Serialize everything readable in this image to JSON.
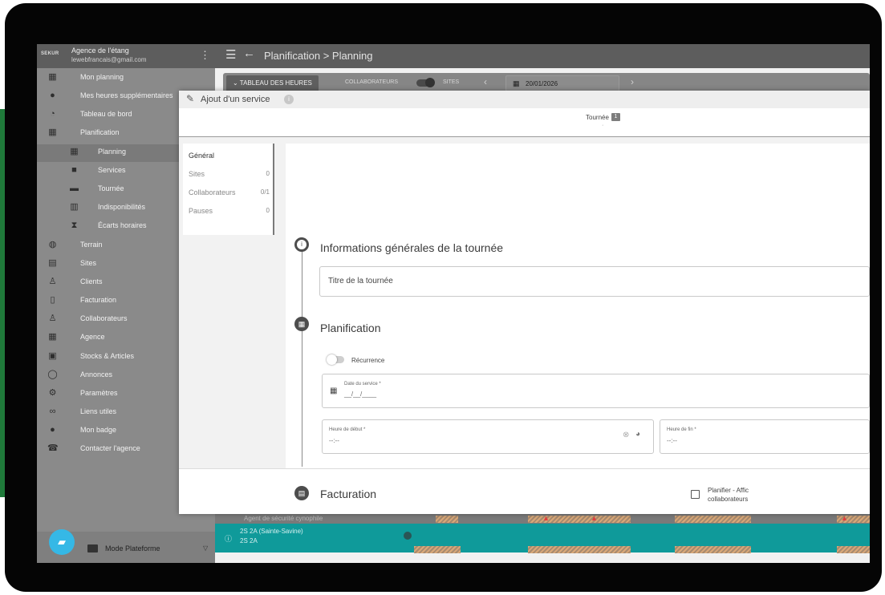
{
  "app": {
    "logo": "SEKUR",
    "agency_name": "Agence de l'étang",
    "agency_email": "lewebfrancais@gmail.com",
    "breadcrumb": "Planification  >  Planning"
  },
  "sidebar": {
    "items": [
      {
        "label": "Mon planning",
        "icon": "calendar-icon"
      },
      {
        "label": "Mes heures supplémentaires",
        "icon": "user-clock-icon"
      },
      {
        "label": "Tableau de bord",
        "icon": "dashboard-icon"
      },
      {
        "label": "Planification",
        "icon": "calendar-grid-icon"
      },
      {
        "label": "Planning",
        "icon": "calendar-icon"
      },
      {
        "label": "Services",
        "icon": "briefcase-icon"
      },
      {
        "label": "Tournée",
        "icon": "car-icon"
      },
      {
        "label": "Indisponibilités",
        "icon": "calendar-off-icon"
      },
      {
        "label": "Écarts horaires",
        "icon": "hourglass-icon"
      },
      {
        "label": "Terrain",
        "icon": "globe-icon"
      },
      {
        "label": "Sites",
        "icon": "building-icon"
      },
      {
        "label": "Clients",
        "icon": "client-icon"
      },
      {
        "label": "Facturation",
        "icon": "invoice-icon"
      },
      {
        "label": "Collaborateurs",
        "icon": "user-icon"
      },
      {
        "label": "Agence",
        "icon": "agency-icon"
      },
      {
        "label": "Stocks & Articles",
        "icon": "boxes-icon"
      },
      {
        "label": "Annonces",
        "icon": "chat-icon"
      },
      {
        "label": "Paramètres",
        "icon": "settings-icon"
      },
      {
        "label": "Liens utiles",
        "icon": "link-icon"
      },
      {
        "label": "Mon badge",
        "icon": "badge-icon"
      },
      {
        "label": "Contacter l'agence",
        "icon": "phone-icon"
      }
    ],
    "mode_label": "Mode Plateforme"
  },
  "toolbar": {
    "tab_hours": "TABLEAU DES HEURES",
    "collaborateurs": "COLLABORATEURS",
    "sites": "SITES",
    "date": "20/01/2026"
  },
  "background": {
    "row1_label": "Agent de sécurité cynophile",
    "row2_line1": "2S 2A (Sainte-Savine)",
    "row2_line2": "2S 2A"
  },
  "modal": {
    "title": "Ajout d'un service",
    "tab": "Tournée",
    "tab_badge": "1",
    "side_tabs": [
      {
        "label": "Général",
        "count": ""
      },
      {
        "label": "Sites",
        "count": "0"
      },
      {
        "label": "Collaborateurs",
        "count": "0/1"
      },
      {
        "label": "Pauses",
        "count": "0"
      }
    ],
    "section_general": "Informations générales de la tournée",
    "title_placeholder": "Titre de la tournée",
    "section_planning": "Planification",
    "recurrence": "Récurrence",
    "date_label": "Date du service *",
    "date_value": "__/__/____",
    "start_label": "Heure de début *",
    "start_value": "--:--",
    "end_label": "Heure de fin *",
    "end_value": "--:--",
    "section_billing": "Facturation",
    "plan_label_1": "Planifier - Affic",
    "plan_label_2": "collaborateurs"
  }
}
